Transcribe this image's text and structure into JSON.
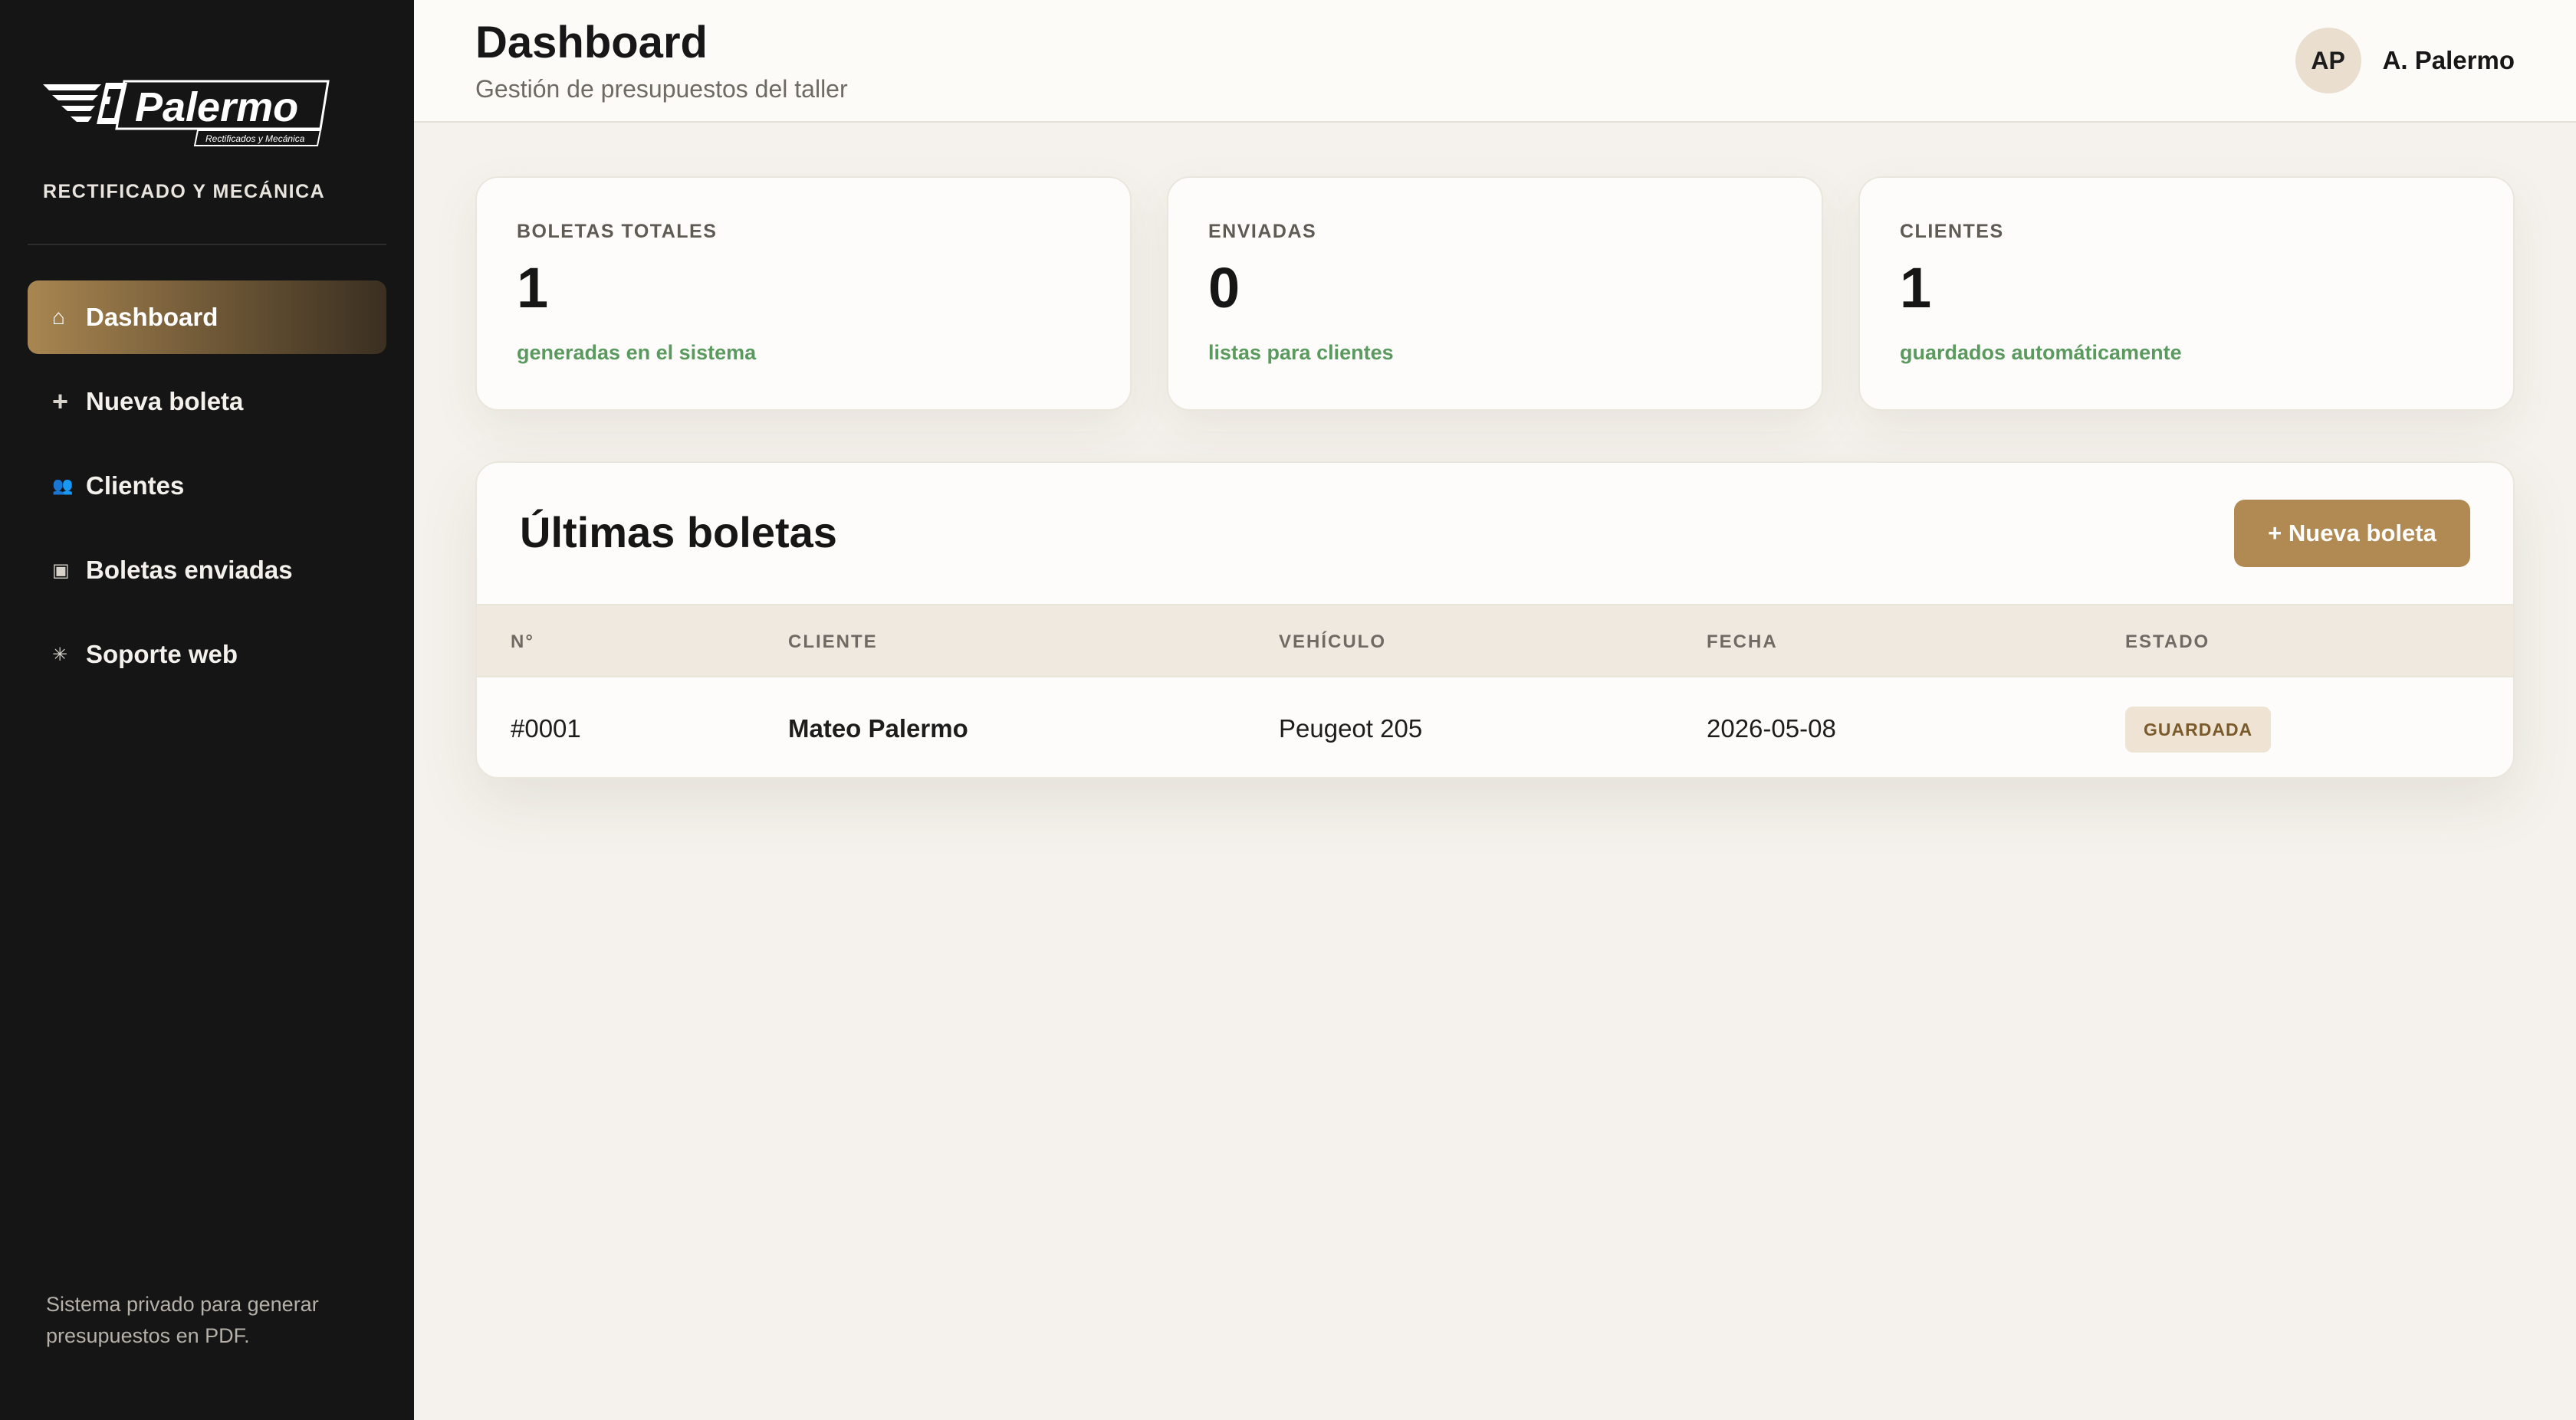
{
  "sidebar": {
    "logo_text": "Palermo",
    "logo_subtext": "Rectificados y Mecánica",
    "tagline": "RECTIFICADO Y MECÁNICA",
    "items": [
      {
        "label": "Dashboard",
        "icon": "home-icon",
        "glyph": "⌂",
        "active": true
      },
      {
        "label": "Nueva boleta",
        "icon": "plus-icon",
        "glyph": "+",
        "active": false
      },
      {
        "label": "Clientes",
        "icon": "users-icon",
        "glyph": "👥",
        "active": false
      },
      {
        "label": "Boletas enviadas",
        "icon": "document-icon",
        "glyph": "▣",
        "active": false
      },
      {
        "label": "Soporte web",
        "icon": "sparkle-icon",
        "glyph": "✳",
        "active": false
      }
    ],
    "footer": "Sistema privado para generar presupuestos en PDF."
  },
  "header": {
    "title": "Dashboard",
    "subtitle": "Gestión de presupuestos del taller",
    "user_initials": "AP",
    "user_name": "A. Palermo"
  },
  "stats": [
    {
      "label": "BOLETAS TOTALES",
      "value": "1",
      "note": "generadas en el sistema"
    },
    {
      "label": "ENVIADAS",
      "value": "0",
      "note": "listas para clientes"
    },
    {
      "label": "CLIENTES",
      "value": "1",
      "note": "guardados automáticamente"
    }
  ],
  "recent": {
    "title": "Últimas boletas",
    "new_button": "+ Nueva boleta",
    "columns": [
      "N°",
      "CLIENTE",
      "VEHÍCULO",
      "FECHA",
      "ESTADO"
    ],
    "rows": [
      {
        "number": "#0001",
        "client": "Mateo Palermo",
        "vehicle": "Peugeot 205",
        "date": "2026-05-08",
        "status": "GUARDADA"
      }
    ]
  },
  "colors": {
    "accent": "#b08a52",
    "sidebar_bg": "#151515",
    "positive_text": "#5a9a5f",
    "page_bg": "#f5f2ed"
  }
}
